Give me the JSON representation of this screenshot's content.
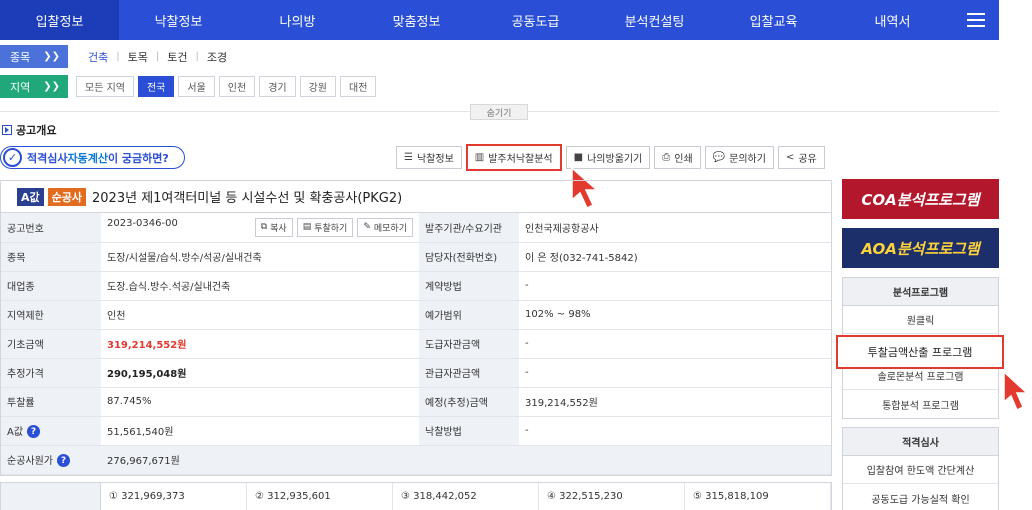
{
  "topnav": {
    "items": [
      "입찰정보",
      "낙찰정보",
      "나의방",
      "맞춤정보",
      "공동도급",
      "분석컨설팅",
      "입찰교육",
      "내역서"
    ],
    "active_index": 0
  },
  "filters": {
    "kind_label": "종목",
    "kind_tabs": [
      "건축",
      "토목",
      "토건",
      "조경"
    ],
    "kind_active": "건축",
    "region_label": "지역",
    "regions": [
      "모든 지역",
      "전국",
      "서울",
      "인천",
      "경기",
      "강원",
      "대전"
    ],
    "region_active": "전국",
    "hide_label": "숨기기"
  },
  "section_title": "공고개요",
  "auto_calc": {
    "prefix": "적격심사 ",
    "highlight": "자동계산",
    "suffix": "이 궁금하면?"
  },
  "actions": [
    "낙찰정보",
    "발주처낙찰분석",
    "나의방옮기기",
    "인쇄",
    "문의하기",
    "공유"
  ],
  "notice": {
    "badge_a": "A값",
    "badge_s": "순공사",
    "title": "2023년 제1여객터미널 등 시설수선 및 확충공사(PKG2)"
  },
  "mini_buttons": [
    "복사",
    "투찰하기",
    "메모하기"
  ],
  "rows": [
    {
      "k1": "공고번호",
      "v1": "2023-0346-00",
      "k2": "발주기관/수요기관",
      "v2": "인천국제공항공사"
    },
    {
      "k1": "종목",
      "v1": "도장/시설물/습식.방수/석공/실내건축",
      "k2": "담당자(전화번호)",
      "v2": "이 은 정(032-741-5842)"
    },
    {
      "k1": "대업종",
      "v1": "도장.습식.방수.석공/실내건축",
      "k2": "계약방법",
      "v2": "-"
    },
    {
      "k1": "지역제한",
      "v1": "인천",
      "k2": "예가범위",
      "v2": "102% ~ 98%"
    },
    {
      "k1": "기초금액",
      "v1": "319,214,552원",
      "k2": "도급자관금액",
      "v2": "-"
    },
    {
      "k1": "추정가격",
      "v1": "290,195,048원",
      "k2": "관급자관금액",
      "v2": "-"
    },
    {
      "k1": "투찰률",
      "v1": "87.745%",
      "k2": "예정(추정)금액",
      "v2": "319,214,552원"
    },
    {
      "k1": "A값",
      "v1": "51,561,540원",
      "k2": "낙찰방법",
      "v2": "-"
    },
    {
      "k1": "순공사원가",
      "v1": "276,967,671원"
    }
  ],
  "rates": [
    "① 321,969,373",
    "② 312,935,601",
    "③ 318,442,052",
    "④ 322,515,230",
    "⑤ 315,818,109"
  ],
  "side": {
    "coa": "COA분석프로그램",
    "aoa": "AOA분석프로그램",
    "panel1_head": "분석프로그램",
    "panel1_items": [
      "원클릭",
      "투찰금액산출 프로그램",
      "솔로몬분석 프로그램",
      "통합분석 프로그램"
    ],
    "panel2_head": "적격심사",
    "panel2_items": [
      "입찰참여 한도액 간단계산",
      "공동도급 가능실적 확인"
    ]
  },
  "colors": {
    "nav_blue": "#2a4fd6",
    "highlight_red": "#e23a2f",
    "region_green": "#21a87a",
    "amount_red": "#e23a2f"
  }
}
